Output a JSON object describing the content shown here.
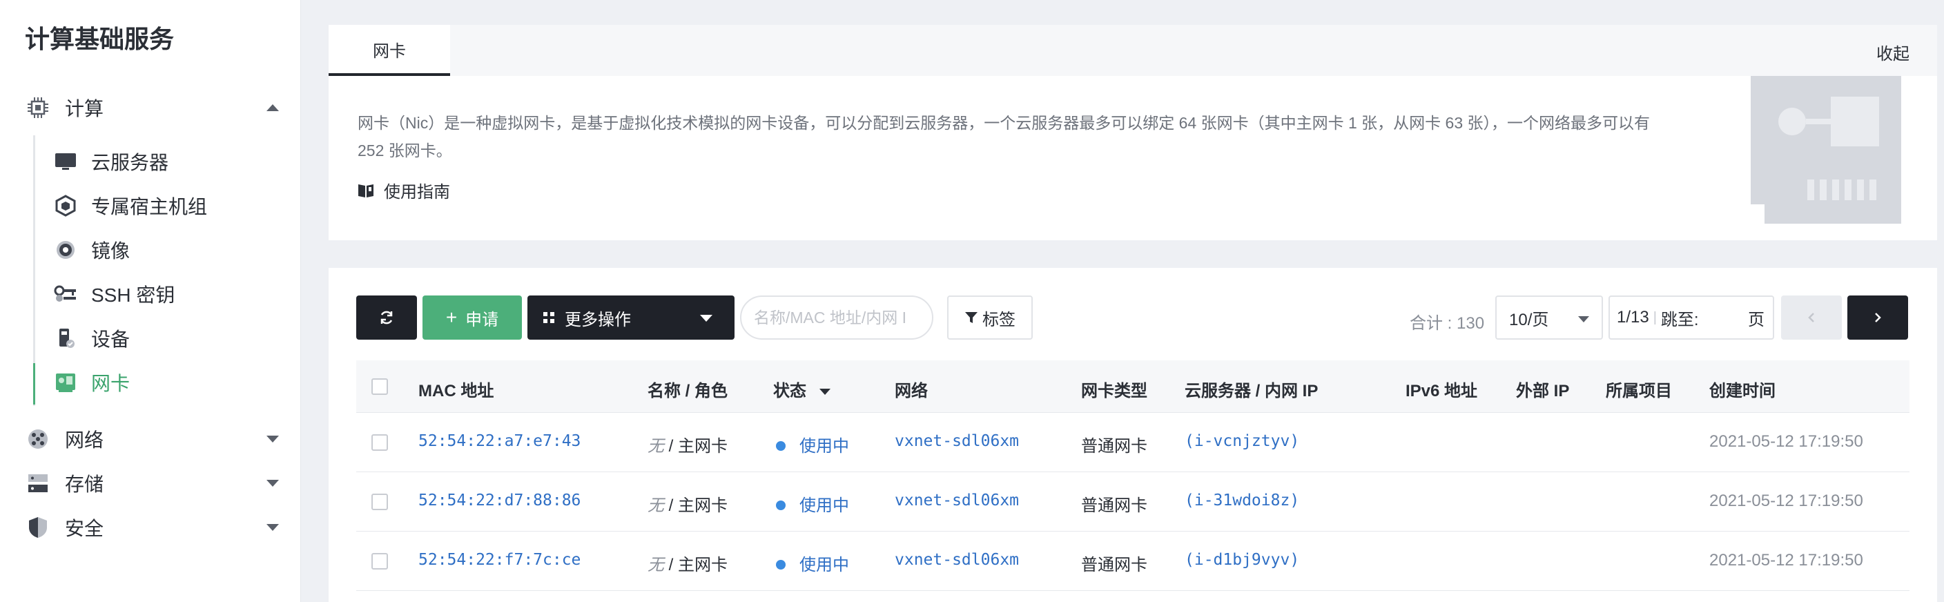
{
  "sidebar": {
    "title": "计算基础服务",
    "compute_group": {
      "label": "计算",
      "icon": "cpu-icon"
    },
    "items": [
      {
        "label": "云服务器",
        "icon": "monitor-icon"
      },
      {
        "label": "专属宿主机组",
        "icon": "hexagon-icon"
      },
      {
        "label": "镜像",
        "icon": "disc-icon"
      },
      {
        "label": "SSH 密钥",
        "icon": "key-icon"
      },
      {
        "label": "设备",
        "icon": "device-icon"
      },
      {
        "label": "网卡",
        "icon": "nic-icon",
        "active": true
      }
    ],
    "other_groups": [
      {
        "label": "网络",
        "icon": "network-icon"
      },
      {
        "label": "存储",
        "icon": "storage-icon"
      },
      {
        "label": "安全",
        "icon": "shield-icon"
      }
    ],
    "accent_color": "#4caf7a"
  },
  "info": {
    "tab_label": "网卡",
    "collapse_label": "收起",
    "description": "网卡（Nic）是一种虚拟网卡，是基于虚拟化技术模拟的网卡设备，可以分配到云服务器，一个云服务器最多可以绑定 64 张网卡（其中主网卡 1 张，从网卡 63 张），一个网络最多可以有 252 张网卡。",
    "guide_label": "使用指南"
  },
  "toolbar": {
    "apply_label": "申请",
    "more_label": "更多操作",
    "search_placeholder": "名称/MAC 地址/内网 I",
    "tag_label": "标签",
    "total_label": "合计 : 130",
    "page_size": "10/页",
    "page_current": "1/13",
    "jump_label": "跳至:",
    "page_unit": "页"
  },
  "table": {
    "columns": [
      "MAC 地址",
      "名称 / 角色",
      "状态",
      "网络",
      "网卡类型",
      "云服务器 / 内网 IP",
      "IPv6 地址",
      "外部 IP",
      "所属项目",
      "创建时间"
    ],
    "rows": [
      {
        "mac": "52:54:22:a7:e7:43",
        "name": "无",
        "role": "/ 主网卡",
        "status": "使用中",
        "network": "vxnet-sdl06xm",
        "type": "普通网卡",
        "server": "(i-vcnjztyv)",
        "ipv6": "",
        "external": "",
        "project": "",
        "created": "2021-05-12 17:19:50"
      },
      {
        "mac": "52:54:22:d7:88:86",
        "name": "无",
        "role": "/ 主网卡",
        "status": "使用中",
        "network": "vxnet-sdl06xm",
        "type": "普通网卡",
        "server": "(i-31wdoi8z)",
        "ipv6": "",
        "external": "",
        "project": "",
        "created": "2021-05-12 17:19:50"
      },
      {
        "mac": "52:54:22:f7:7c:ce",
        "name": "无",
        "role": "/ 主网卡",
        "status": "使用中",
        "network": "vxnet-sdl06xm",
        "type": "普通网卡",
        "server": "(i-d1bj9vyv)",
        "ipv6": "",
        "external": "",
        "project": "",
        "created": "2021-05-12 17:19:50"
      }
    ]
  },
  "colors": {
    "link": "#2f6fc5",
    "status_dot": "#3a8be0",
    "dark_button": "#1f2229",
    "primary_button": "#4caf7a"
  }
}
